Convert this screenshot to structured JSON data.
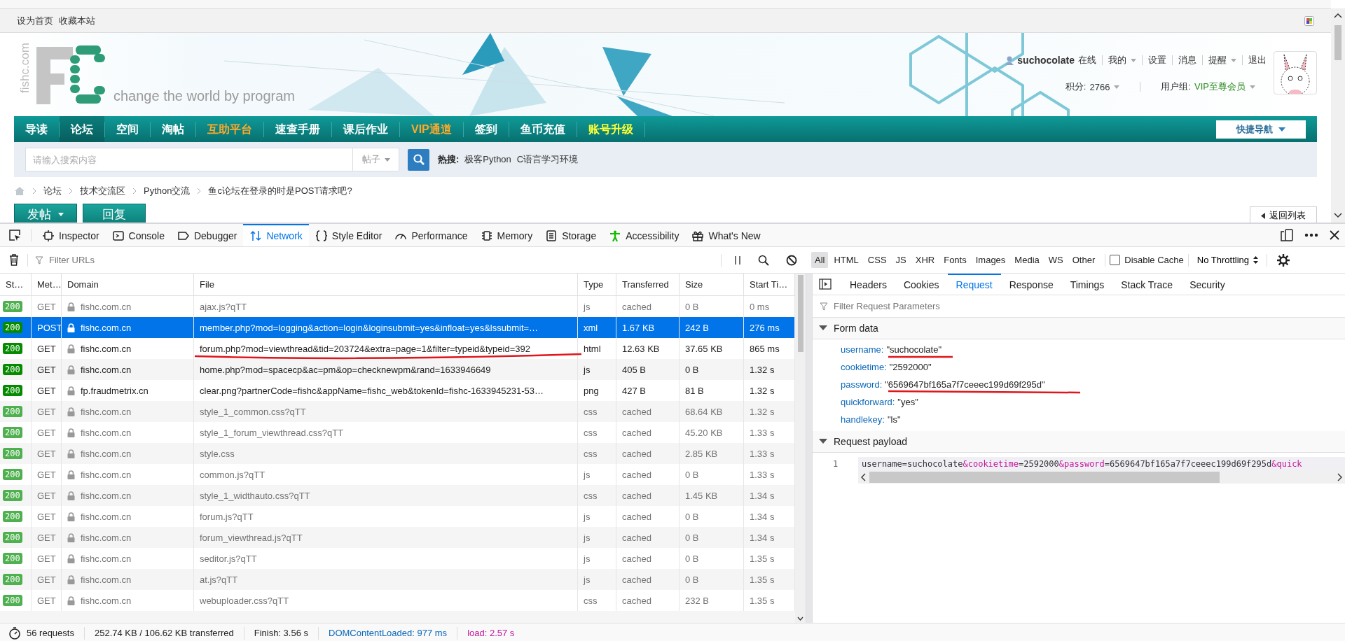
{
  "site": {
    "top_links": [
      "设为首页",
      "收藏本站"
    ],
    "logo": {
      "vertical_text": "fishc.com",
      "slogan": "change the world by program"
    },
    "user": {
      "name": "suchocolate",
      "status": "在线",
      "menu": [
        {
          "label": "我的",
          "dropdown": true
        },
        {
          "label": "设置",
          "dropdown": false
        },
        {
          "label": "消息",
          "dropdown": false
        },
        {
          "label": "提醒",
          "dropdown": true
        },
        {
          "label": "退出",
          "dropdown": false
        }
      ],
      "points_label": "积分:",
      "points": "2766",
      "group_label": "用户组:",
      "group": "VIP至尊会员"
    },
    "nav": [
      {
        "label": "导读",
        "kind": "normal",
        "selected": false
      },
      {
        "label": "论坛",
        "kind": "normal",
        "selected": true
      },
      {
        "label": "空间",
        "kind": "normal",
        "selected": false
      },
      {
        "label": "淘帖",
        "kind": "normal",
        "selected": false
      },
      {
        "label": "互助平台",
        "kind": "highlight",
        "selected": false
      },
      {
        "label": "速查手册",
        "kind": "normal",
        "selected": false
      },
      {
        "label": "课后作业",
        "kind": "normal",
        "selected": false
      },
      {
        "label": "VIP通道",
        "kind": "highlight",
        "selected": false
      },
      {
        "label": "签到",
        "kind": "normal",
        "selected": false
      },
      {
        "label": "鱼币充值",
        "kind": "normal",
        "selected": false
      },
      {
        "label": "账号升级",
        "kind": "upgrade",
        "selected": false
      }
    ],
    "quick_nav": "快捷导航",
    "search": {
      "placeholder": "请输入搜索内容",
      "scope": "帖子",
      "hot_label": "热搜:",
      "hot": [
        "极客Python",
        "C语言学习环境"
      ]
    },
    "breadcrumb": [
      "论坛",
      "技术交流区",
      "Python交流",
      "鱼c论坛在登录的时是POST请求吧?"
    ],
    "actions": [
      {
        "label": "发帖",
        "dropdown": true
      },
      {
        "label": "回复",
        "dropdown": false
      }
    ],
    "back_link": "返回列表"
  },
  "devtools": {
    "tabs": [
      {
        "label": "Inspector",
        "selected": false
      },
      {
        "label": "Console",
        "selected": false
      },
      {
        "label": "Debugger",
        "selected": false
      },
      {
        "label": "Network",
        "selected": true
      },
      {
        "label": "Style Editor",
        "selected": false
      },
      {
        "label": "Performance",
        "selected": false
      },
      {
        "label": "Memory",
        "selected": false
      },
      {
        "label": "Storage",
        "selected": false
      },
      {
        "label": "Accessibility",
        "selected": false
      },
      {
        "label": "What's New",
        "selected": false
      }
    ],
    "filter_placeholder": "Filter URLs",
    "type_filters": [
      {
        "label": "All",
        "selected": true
      },
      {
        "label": "HTML",
        "selected": false
      },
      {
        "label": "CSS",
        "selected": false
      },
      {
        "label": "JS",
        "selected": false
      },
      {
        "label": "XHR",
        "selected": false
      },
      {
        "label": "Fonts",
        "selected": false
      },
      {
        "label": "Images",
        "selected": false
      },
      {
        "label": "Media",
        "selected": false
      },
      {
        "label": "WS",
        "selected": false
      },
      {
        "label": "Other",
        "selected": false
      }
    ],
    "disable_cache": {
      "label": "Disable Cache",
      "checked": false
    },
    "throttling": "No Throttling",
    "columns": [
      "St…",
      "Met…",
      "Domain",
      "File",
      "Type",
      "Transferred",
      "Size",
      "Start Ti…"
    ],
    "rows": [
      {
        "status": "200",
        "method": "GET",
        "domain": "fishc.com.cn",
        "file": "ajax.js?qTT",
        "type": "js",
        "transferred": "cached",
        "size": "0 B",
        "start": "0 ms",
        "from_cache": true,
        "selected": false
      },
      {
        "status": "200",
        "method": "POST",
        "domain": "fishc.com.cn",
        "file": "member.php?mod=logging&action=login&loginsubmit=yes&infloat=yes&lssubmit=…",
        "type": "xml",
        "transferred": "1.67 KB",
        "size": "242 B",
        "start": "276 ms",
        "from_cache": false,
        "selected": true
      },
      {
        "status": "200",
        "method": "GET",
        "domain": "fishc.com.cn",
        "file": "forum.php?mod=viewthread&tid=203724&extra=page=1&filter=typeid&typeid=392",
        "type": "html",
        "transferred": "12.63 KB",
        "size": "37.65 KB",
        "start": "865 ms",
        "from_cache": false,
        "selected": false
      },
      {
        "status": "200",
        "method": "GET",
        "domain": "fishc.com.cn",
        "file": "home.php?mod=spacecp&ac=pm&op=checknewpm&rand=1633946649",
        "type": "js",
        "transferred": "405 B",
        "size": "0 B",
        "start": "1.32 s",
        "from_cache": false,
        "selected": false
      },
      {
        "status": "200",
        "method": "GET",
        "domain": "fp.fraudmetrix.cn",
        "file": "clear.png?partnerCode=fishc&appName=fishc_web&tokenId=fishc-1633945231-53…",
        "type": "png",
        "transferred": "427 B",
        "size": "81 B",
        "start": "1.32 s",
        "from_cache": false,
        "selected": false
      },
      {
        "status": "200",
        "method": "GET",
        "domain": "fishc.com.cn",
        "file": "style_1_common.css?qTT",
        "type": "css",
        "transferred": "cached",
        "size": "68.64 KB",
        "start": "1.32 s",
        "from_cache": true,
        "selected": false
      },
      {
        "status": "200",
        "method": "GET",
        "domain": "fishc.com.cn",
        "file": "style_1_forum_viewthread.css?qTT",
        "type": "css",
        "transferred": "cached",
        "size": "45.20 KB",
        "start": "1.33 s",
        "from_cache": true,
        "selected": false
      },
      {
        "status": "200",
        "method": "GET",
        "domain": "fishc.com.cn",
        "file": "style.css",
        "type": "css",
        "transferred": "cached",
        "size": "2.85 KB",
        "start": "1.33 s",
        "from_cache": true,
        "selected": false
      },
      {
        "status": "200",
        "method": "GET",
        "domain": "fishc.com.cn",
        "file": "common.js?qTT",
        "type": "js",
        "transferred": "cached",
        "size": "0 B",
        "start": "1.33 s",
        "from_cache": true,
        "selected": false
      },
      {
        "status": "200",
        "method": "GET",
        "domain": "fishc.com.cn",
        "file": "style_1_widthauto.css?qTT",
        "type": "css",
        "transferred": "cached",
        "size": "1.45 KB",
        "start": "1.34 s",
        "from_cache": true,
        "selected": false
      },
      {
        "status": "200",
        "method": "GET",
        "domain": "fishc.com.cn",
        "file": "forum.js?qTT",
        "type": "js",
        "transferred": "cached",
        "size": "0 B",
        "start": "1.34 s",
        "from_cache": true,
        "selected": false
      },
      {
        "status": "200",
        "method": "GET",
        "domain": "fishc.com.cn",
        "file": "forum_viewthread.js?qTT",
        "type": "js",
        "transferred": "cached",
        "size": "0 B",
        "start": "1.34 s",
        "from_cache": true,
        "selected": false
      },
      {
        "status": "200",
        "method": "GET",
        "domain": "fishc.com.cn",
        "file": "seditor.js?qTT",
        "type": "js",
        "transferred": "cached",
        "size": "0 B",
        "start": "1.35 s",
        "from_cache": true,
        "selected": false
      },
      {
        "status": "200",
        "method": "GET",
        "domain": "fishc.com.cn",
        "file": "at.js?qTT",
        "type": "js",
        "transferred": "cached",
        "size": "0 B",
        "start": "1.35 s",
        "from_cache": true,
        "selected": false
      },
      {
        "status": "200",
        "method": "GET",
        "domain": "fishc.com.cn",
        "file": "webuploader.css?qTT",
        "type": "css",
        "transferred": "cached",
        "size": "232 B",
        "start": "1.35 s",
        "from_cache": true,
        "selected": false
      }
    ],
    "detail_tabs": [
      {
        "label": "Headers",
        "selected": false
      },
      {
        "label": "Cookies",
        "selected": false
      },
      {
        "label": "Request",
        "selected": true
      },
      {
        "label": "Response",
        "selected": false
      },
      {
        "label": "Timings",
        "selected": false
      },
      {
        "label": "Stack Trace",
        "selected": false
      },
      {
        "label": "Security",
        "selected": false
      }
    ],
    "param_filter_placeholder": "Filter Request Parameters",
    "form_data": {
      "title": "Form data",
      "expanded": true,
      "fields": [
        {
          "name": "username:",
          "value": "\"suchocolate\""
        },
        {
          "name": "cookietime:",
          "value": "\"2592000\""
        },
        {
          "name": "password:",
          "value": "\"6569647bf165a7f7ceeec199d69f295d\""
        },
        {
          "name": "quickforward:",
          "value": "\"yes\""
        },
        {
          "name": "handlekey:",
          "value": "\"ls\""
        }
      ]
    },
    "payload": {
      "title": "Request payload",
      "expanded": true,
      "line_number": "1",
      "segments": [
        {
          "text": "username=suchocolate",
          "kind": "plain"
        },
        {
          "text": "&cookietime",
          "kind": "key"
        },
        {
          "text": "=2592000",
          "kind": "plain"
        },
        {
          "text": "&password",
          "kind": "key"
        },
        {
          "text": "=6569647bf165a7f7ceeec199d69f295d",
          "kind": "plain"
        },
        {
          "text": "&quick",
          "kind": "key"
        }
      ]
    },
    "status_bar": {
      "requests": "56 requests",
      "transferred": "252.74 KB / 106.62 KB transferred",
      "finish": "Finish: 3.56 s",
      "dom_content_loaded": "DOMContentLoaded: 977 ms",
      "load": "load: 2.57 s"
    }
  }
}
